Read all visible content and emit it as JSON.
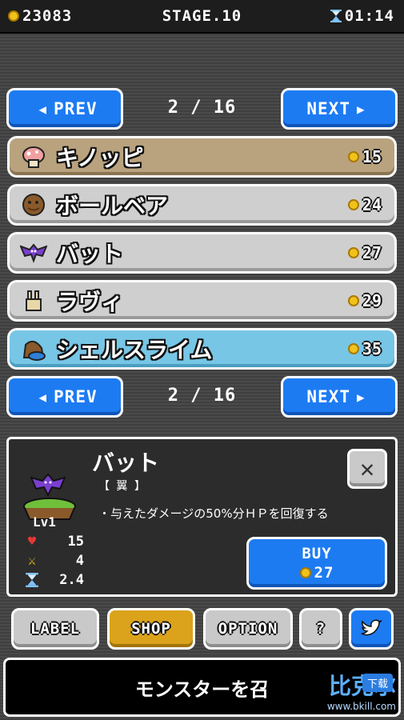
{
  "topbar": {
    "coins": "23083",
    "stage": "STAGE.10",
    "timer": "01:14"
  },
  "nav": {
    "prev_label": "PREV",
    "next_label": "NEXT",
    "page_indicator": "2 / 16"
  },
  "shop_items": [
    {
      "name": "キノッピ",
      "price": "15",
      "icon": "mushroom-icon",
      "state": "selected"
    },
    {
      "name": "ボールベア",
      "price": "24",
      "icon": "ball-bear-icon",
      "state": "normal"
    },
    {
      "name": "バット",
      "price": "27",
      "icon": "bat-icon",
      "state": "normal"
    },
    {
      "name": "ラヴィ",
      "price": "29",
      "icon": "rabbit-icon",
      "state": "normal"
    },
    {
      "name": "シェルスライム",
      "price": "35",
      "icon": "shell-slime-icon",
      "state": "highlighted"
    }
  ],
  "detail": {
    "name": "バット",
    "tag": "【 翼 】",
    "description": "・与えたダメージの50%分ＨＰを回復する",
    "level": "Lv1",
    "stats": {
      "hp": "15",
      "attack": "4",
      "speed": "2.4"
    },
    "buy_label": "BUY",
    "buy_price": "27"
  },
  "tabs": {
    "label": "LABEL",
    "shop": "SHOP",
    "option": "OPTION",
    "help": "?"
  },
  "banner": {
    "text": "モンスターを召"
  },
  "watermark": {
    "line1": "比克尔",
    "line2": "www.bkill.com",
    "tag": "下载"
  },
  "colors": {
    "accent_blue": "#1d7bf2",
    "gold": "#f1c21b",
    "selected_row": "#b9a27e",
    "highlight_row": "#77c6e6",
    "active_tab": "#dba21b"
  }
}
